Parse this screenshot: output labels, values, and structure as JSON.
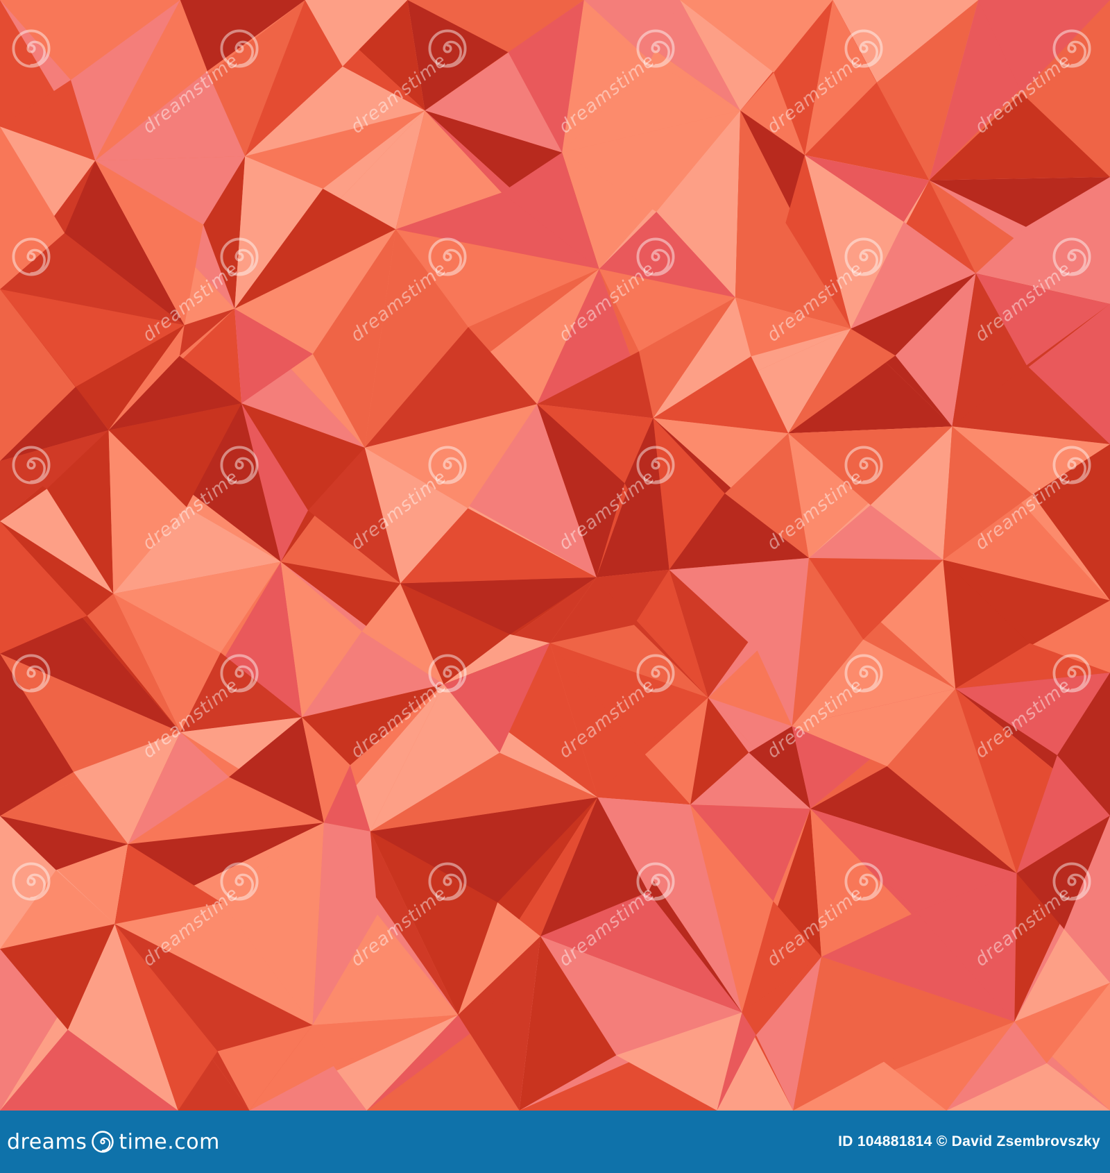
{
  "image": {
    "subject": "low-poly triangle mosaic",
    "palette": [
      "#b82a1e",
      "#d03a26",
      "#e44c32",
      "#ef6446",
      "#f87758",
      "#fc8b6c",
      "#fd9f86",
      "#f47e7a",
      "#e9595b",
      "#c9341f"
    ]
  },
  "watermark": {
    "repeated_text": "dreamstime",
    "icon": "spiral-logo-icon"
  },
  "footer": {
    "brand_prefix": "dreams",
    "brand_suffix": "time.com",
    "brand_icon": "spiral-logo-icon",
    "photo_id": "ID 104881814 © David Zsembrovszky",
    "background": "#0f72aa"
  }
}
